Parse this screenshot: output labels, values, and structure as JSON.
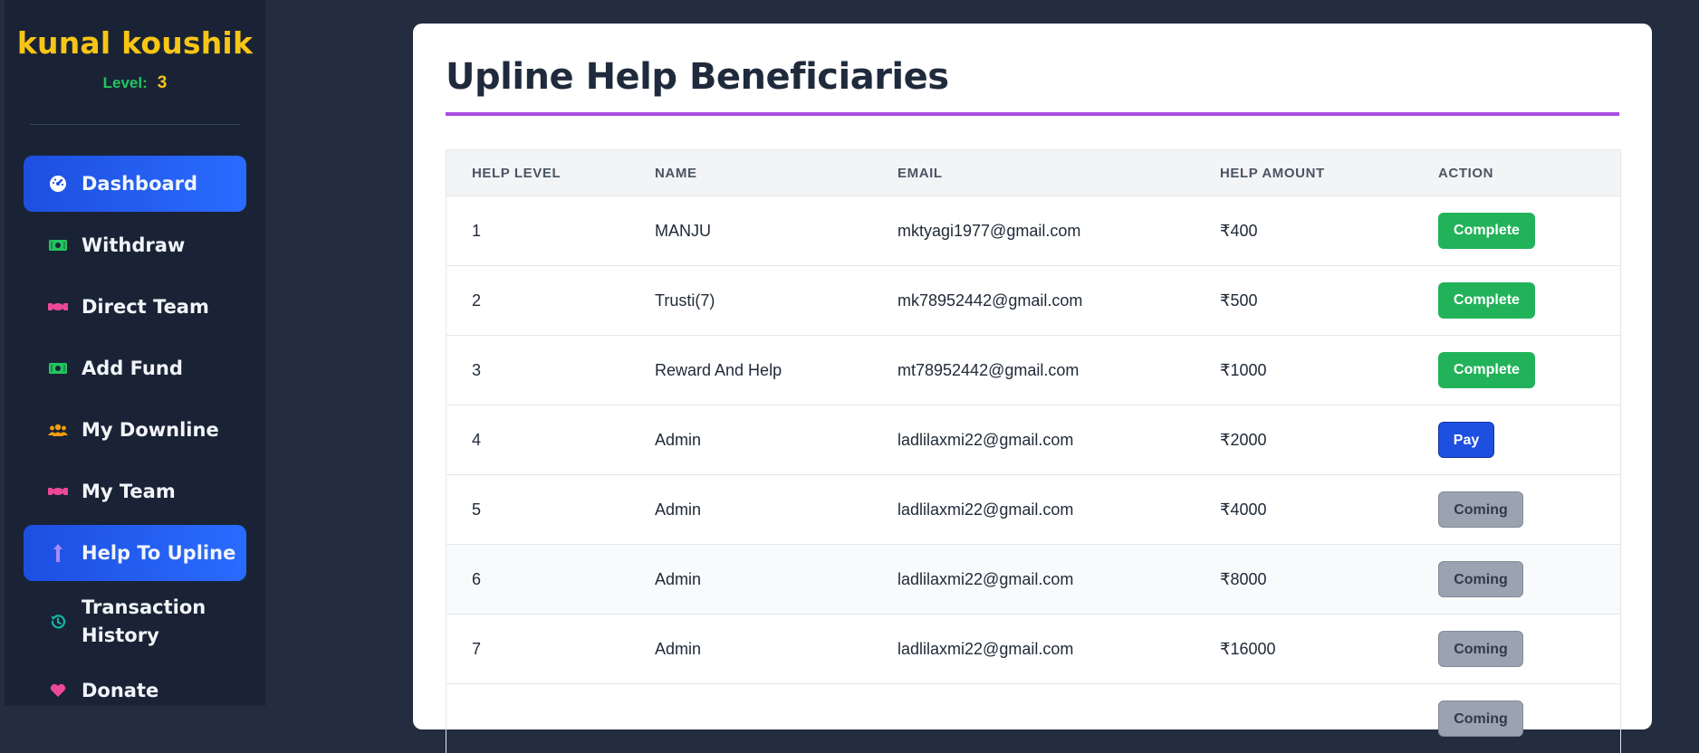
{
  "sidebar": {
    "user_name": "kunal koushik",
    "level_label": "Level:",
    "level_value": "3",
    "items": [
      {
        "label": "Dashboard",
        "icon": "gauge-icon"
      },
      {
        "label": "Withdraw",
        "icon": "money-icon"
      },
      {
        "label": "Direct Team",
        "icon": "handshake-icon"
      },
      {
        "label": "Add Fund",
        "icon": "money-icon"
      },
      {
        "label": "My Downline",
        "icon": "users-icon"
      },
      {
        "label": "My Team",
        "icon": "handshake-icon"
      },
      {
        "label": "Help To Upline",
        "icon": "arrow-up-icon"
      },
      {
        "label": "Transaction History",
        "icon": "history-icon"
      },
      {
        "label": "Donate",
        "icon": "heart-icon"
      }
    ],
    "active_items": [
      "Dashboard",
      "Help To Upline"
    ]
  },
  "main": {
    "title": "Upline Help Beneficiaries",
    "columns": [
      "HELP LEVEL",
      "NAME",
      "EMAIL",
      "HELP AMOUNT",
      "ACTION"
    ],
    "rows": [
      {
        "level": "1",
        "name": "MANJU",
        "email": "mktyagi1977@gmail.com",
        "amount": "₹400",
        "action": "Complete"
      },
      {
        "level": "2",
        "name": "Trusti(7)",
        "email": "mk78952442@gmail.com",
        "amount": "₹500",
        "action": "Complete"
      },
      {
        "level": "3",
        "name": "Reward And Help",
        "email": "mt78952442@gmail.com",
        "amount": "₹1000",
        "action": "Complete"
      },
      {
        "level": "4",
        "name": "Admin",
        "email": "ladlilaxmi22@gmail.com",
        "amount": "₹2000",
        "action": "Pay"
      },
      {
        "level": "5",
        "name": "Admin",
        "email": "ladlilaxmi22@gmail.com",
        "amount": "₹4000",
        "action": "Coming"
      },
      {
        "level": "6",
        "name": "Admin",
        "email": "ladlilaxmi22@gmail.com",
        "amount": "₹8000",
        "action": "Coming"
      },
      {
        "level": "7",
        "name": "Admin",
        "email": "ladlilaxmi22@gmail.com",
        "amount": "₹16000",
        "action": "Coming"
      },
      {
        "level": "",
        "name": "",
        "email": "",
        "amount": "",
        "action": "Coming"
      }
    ]
  },
  "colors": {
    "accent": "#a84be0",
    "active_nav": "#2563eb",
    "complete": "#22b35a",
    "pay": "#1d4fe0",
    "coming": "#9ca3b0",
    "brand": "#f7c515"
  }
}
